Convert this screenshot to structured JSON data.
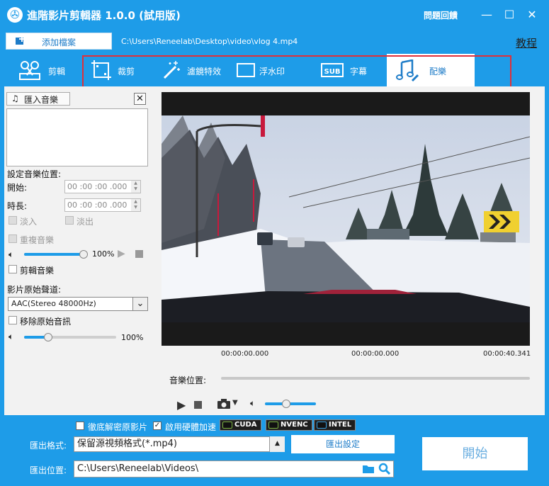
{
  "window": {
    "title": "進階影片剪輯器 1.0.0 (試用版)",
    "help": "問題回饋",
    "minimize": "—",
    "maximize": "☐",
    "close": "✕"
  },
  "file_bar": {
    "add_file": "添加檔案",
    "path": "C:\\Users\\Reneelab\\Desktop\\video\\vlog 4.mp4",
    "tutorial": "教程"
  },
  "tabs": [
    {
      "label": "剪輯",
      "icon": "scissors-film-icon"
    },
    {
      "label": "裁剪",
      "icon": "crop-icon"
    },
    {
      "label": "濾鏡特效",
      "icon": "magic-wand-icon"
    },
    {
      "label": "浮水印",
      "icon": "watermark-icon"
    },
    {
      "label": "字幕",
      "icon": "subtitle-icon"
    },
    {
      "label": "配樂",
      "icon": "music-note-icon"
    }
  ],
  "music_panel": {
    "import_music": "匯入音樂",
    "set_position": "設定音樂位置:",
    "start_label": "開始:",
    "start_value": "00 :00 :00 .000",
    "duration_label": "時長:",
    "duration_value": "00 :00 :00 .000",
    "fade_in": "淡入",
    "fade_out": "淡出",
    "repeat": "重複音樂",
    "music_volume": "100%",
    "trim_music": "剪輯音樂",
    "original_track_label": "影片原始聲道:",
    "original_track_value": "AAC(Stereo 48000Hz)",
    "remove_original": "移除原始音訊",
    "original_volume": "100%"
  },
  "player": {
    "time_start": "00:00:00.000",
    "time_current": "00:00:00.000",
    "time_end": "00:00:40.341",
    "music_position_label": "音樂位置:"
  },
  "output": {
    "deinterlace": "徹底解密原影片",
    "hw_accel": "啟用硬體加速",
    "gpu_badges": [
      "CUDA",
      "NVENC",
      "INTEL"
    ],
    "format_label": "匯出格式:",
    "format_value": "保留源視頻格式(*.mp4)",
    "settings_button": "匯出設定",
    "location_label": "匯出位置:",
    "location_value": "C:\\Users\\Reneelab\\Videos\\",
    "start_button": "開始"
  },
  "colors": {
    "accent": "#1e9ce8",
    "highlight_border": "#e0303a"
  }
}
